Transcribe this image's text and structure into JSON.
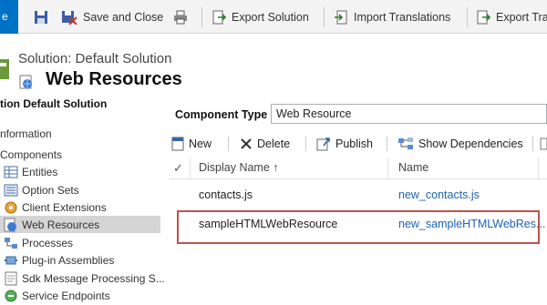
{
  "toolbar": {
    "app_tab": "e",
    "save_and_close": "Save and Close",
    "export_solution": "Export Solution",
    "import_translations": "Import Translations",
    "export_translations": "Export Tra"
  },
  "header": {
    "solution_title": "Solution: Default Solution",
    "page_title": "Web Resources"
  },
  "nav": {
    "heading": "tion Default Solution",
    "information": "nformation",
    "components": "Components",
    "items": [
      {
        "label": "Entities",
        "icon": "entities-icon"
      },
      {
        "label": "Option Sets",
        "icon": "option-sets-icon"
      },
      {
        "label": "Client Extensions",
        "icon": "client-extensions-icon"
      },
      {
        "label": "Web Resources",
        "icon": "web-resources-icon",
        "selected": true
      },
      {
        "label": "Processes",
        "icon": "processes-icon"
      },
      {
        "label": "Plug-in Assemblies",
        "icon": "plugin-assemblies-icon"
      },
      {
        "label": "Sdk Message Processing S...",
        "icon": "sdk-message-icon"
      },
      {
        "label": "Service Endpoints",
        "icon": "service-endpoints-icon"
      }
    ]
  },
  "component_type": {
    "label": "Component Type",
    "value": "Web Resource"
  },
  "grid_toolbar": {
    "new": "New",
    "delete": "Delete",
    "publish": "Publish",
    "show_dependencies": "Show Dependencies"
  },
  "grid": {
    "columns": [
      "Display Name ↑",
      "Name"
    ],
    "rows": [
      {
        "display_name": "contacts.js",
        "name": "new_contacts.js"
      },
      {
        "display_name": "sampleHTMLWebResource",
        "name": "new_sampleHTMLWebRes..."
      }
    ]
  },
  "colors": {
    "accent": "#0072c6",
    "link": "#1c63b7",
    "highlight": "#c0504d"
  }
}
